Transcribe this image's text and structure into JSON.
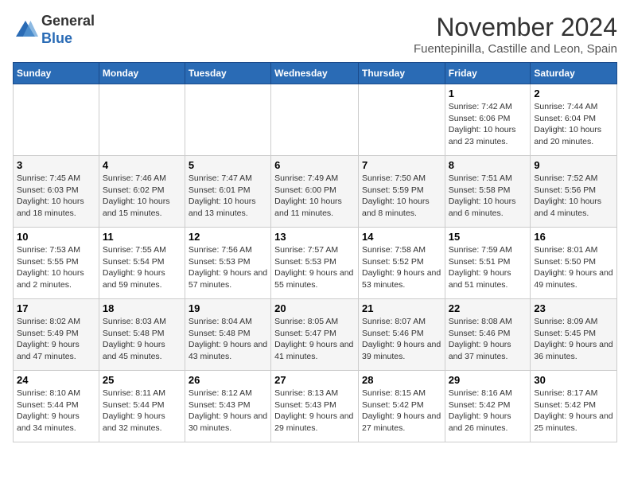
{
  "logo": {
    "general": "General",
    "blue": "Blue"
  },
  "header": {
    "month": "November 2024",
    "location": "Fuentepinilla, Castille and Leon, Spain"
  },
  "weekdays": [
    "Sunday",
    "Monday",
    "Tuesday",
    "Wednesday",
    "Thursday",
    "Friday",
    "Saturday"
  ],
  "weeks": [
    [
      {
        "day": "",
        "info": ""
      },
      {
        "day": "",
        "info": ""
      },
      {
        "day": "",
        "info": ""
      },
      {
        "day": "",
        "info": ""
      },
      {
        "day": "",
        "info": ""
      },
      {
        "day": "1",
        "info": "Sunrise: 7:42 AM\nSunset: 6:06 PM\nDaylight: 10 hours and 23 minutes."
      },
      {
        "day": "2",
        "info": "Sunrise: 7:44 AM\nSunset: 6:04 PM\nDaylight: 10 hours and 20 minutes."
      }
    ],
    [
      {
        "day": "3",
        "info": "Sunrise: 7:45 AM\nSunset: 6:03 PM\nDaylight: 10 hours and 18 minutes."
      },
      {
        "day": "4",
        "info": "Sunrise: 7:46 AM\nSunset: 6:02 PM\nDaylight: 10 hours and 15 minutes."
      },
      {
        "day": "5",
        "info": "Sunrise: 7:47 AM\nSunset: 6:01 PM\nDaylight: 10 hours and 13 minutes."
      },
      {
        "day": "6",
        "info": "Sunrise: 7:49 AM\nSunset: 6:00 PM\nDaylight: 10 hours and 11 minutes."
      },
      {
        "day": "7",
        "info": "Sunrise: 7:50 AM\nSunset: 5:59 PM\nDaylight: 10 hours and 8 minutes."
      },
      {
        "day": "8",
        "info": "Sunrise: 7:51 AM\nSunset: 5:58 PM\nDaylight: 10 hours and 6 minutes."
      },
      {
        "day": "9",
        "info": "Sunrise: 7:52 AM\nSunset: 5:56 PM\nDaylight: 10 hours and 4 minutes."
      }
    ],
    [
      {
        "day": "10",
        "info": "Sunrise: 7:53 AM\nSunset: 5:55 PM\nDaylight: 10 hours and 2 minutes."
      },
      {
        "day": "11",
        "info": "Sunrise: 7:55 AM\nSunset: 5:54 PM\nDaylight: 9 hours and 59 minutes."
      },
      {
        "day": "12",
        "info": "Sunrise: 7:56 AM\nSunset: 5:53 PM\nDaylight: 9 hours and 57 minutes."
      },
      {
        "day": "13",
        "info": "Sunrise: 7:57 AM\nSunset: 5:53 PM\nDaylight: 9 hours and 55 minutes."
      },
      {
        "day": "14",
        "info": "Sunrise: 7:58 AM\nSunset: 5:52 PM\nDaylight: 9 hours and 53 minutes."
      },
      {
        "day": "15",
        "info": "Sunrise: 7:59 AM\nSunset: 5:51 PM\nDaylight: 9 hours and 51 minutes."
      },
      {
        "day": "16",
        "info": "Sunrise: 8:01 AM\nSunset: 5:50 PM\nDaylight: 9 hours and 49 minutes."
      }
    ],
    [
      {
        "day": "17",
        "info": "Sunrise: 8:02 AM\nSunset: 5:49 PM\nDaylight: 9 hours and 47 minutes."
      },
      {
        "day": "18",
        "info": "Sunrise: 8:03 AM\nSunset: 5:48 PM\nDaylight: 9 hours and 45 minutes."
      },
      {
        "day": "19",
        "info": "Sunrise: 8:04 AM\nSunset: 5:48 PM\nDaylight: 9 hours and 43 minutes."
      },
      {
        "day": "20",
        "info": "Sunrise: 8:05 AM\nSunset: 5:47 PM\nDaylight: 9 hours and 41 minutes."
      },
      {
        "day": "21",
        "info": "Sunrise: 8:07 AM\nSunset: 5:46 PM\nDaylight: 9 hours and 39 minutes."
      },
      {
        "day": "22",
        "info": "Sunrise: 8:08 AM\nSunset: 5:46 PM\nDaylight: 9 hours and 37 minutes."
      },
      {
        "day": "23",
        "info": "Sunrise: 8:09 AM\nSunset: 5:45 PM\nDaylight: 9 hours and 36 minutes."
      }
    ],
    [
      {
        "day": "24",
        "info": "Sunrise: 8:10 AM\nSunset: 5:44 PM\nDaylight: 9 hours and 34 minutes."
      },
      {
        "day": "25",
        "info": "Sunrise: 8:11 AM\nSunset: 5:44 PM\nDaylight: 9 hours and 32 minutes."
      },
      {
        "day": "26",
        "info": "Sunrise: 8:12 AM\nSunset: 5:43 PM\nDaylight: 9 hours and 30 minutes."
      },
      {
        "day": "27",
        "info": "Sunrise: 8:13 AM\nSunset: 5:43 PM\nDaylight: 9 hours and 29 minutes."
      },
      {
        "day": "28",
        "info": "Sunrise: 8:15 AM\nSunset: 5:42 PM\nDaylight: 9 hours and 27 minutes."
      },
      {
        "day": "29",
        "info": "Sunrise: 8:16 AM\nSunset: 5:42 PM\nDaylight: 9 hours and 26 minutes."
      },
      {
        "day": "30",
        "info": "Sunrise: 8:17 AM\nSunset: 5:42 PM\nDaylight: 9 hours and 25 minutes."
      }
    ]
  ]
}
